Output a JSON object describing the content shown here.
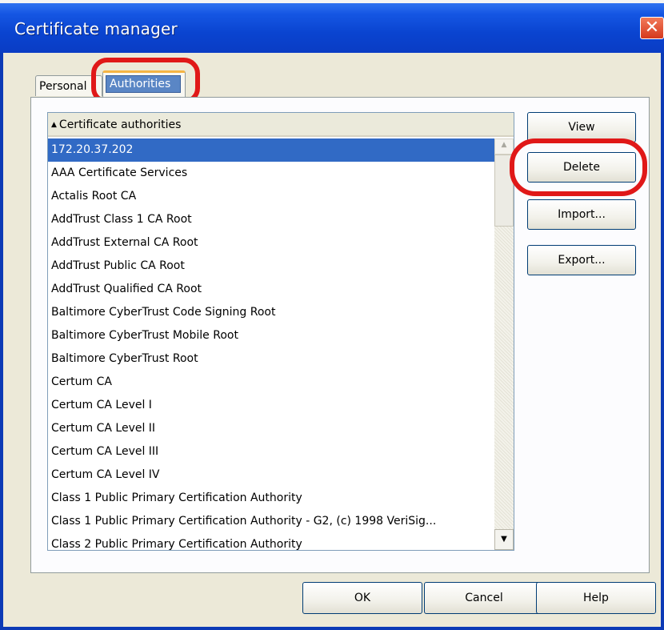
{
  "window": {
    "title": "Certificate manager",
    "close_glyph": "✕"
  },
  "tabs": [
    {
      "label": "Personal",
      "selected": false
    },
    {
      "label": "Authorities",
      "selected": true
    }
  ],
  "list": {
    "header": "Certificate authorities",
    "sort_glyph": "▲",
    "rows": [
      "172.20.37.202",
      "AAA Certificate Services",
      "Actalis Root CA",
      "AddTrust Class 1 CA Root",
      "AddTrust External CA Root",
      "AddTrust Public CA Root",
      "AddTrust Qualified CA Root",
      "Baltimore CyberTrust Code Signing Root",
      "Baltimore CyberTrust Mobile Root",
      "Baltimore CyberTrust Root",
      "Certum CA",
      "Certum CA Level I",
      "Certum CA Level II",
      "Certum CA Level III",
      "Certum CA Level IV",
      "Class 1 Public Primary Certification Authority",
      "Class 1 Public Primary Certification Authority - G2, (c) 1998 VeriSig...",
      "Class 2 Public Primary Certification Authority"
    ],
    "selected_index": 0
  },
  "scrollbar": {
    "up_glyph": "▲",
    "down_glyph": "▼"
  },
  "side_buttons": {
    "view": "View",
    "delete": "Delete",
    "import": "Import...",
    "export": "Export..."
  },
  "bottom_buttons": {
    "ok": "OK",
    "cancel": "Cancel",
    "help": "Help"
  },
  "colors": {
    "titlebar": "#0a44d0",
    "selection": "#316ac5",
    "highlight_circle": "#e01818"
  }
}
